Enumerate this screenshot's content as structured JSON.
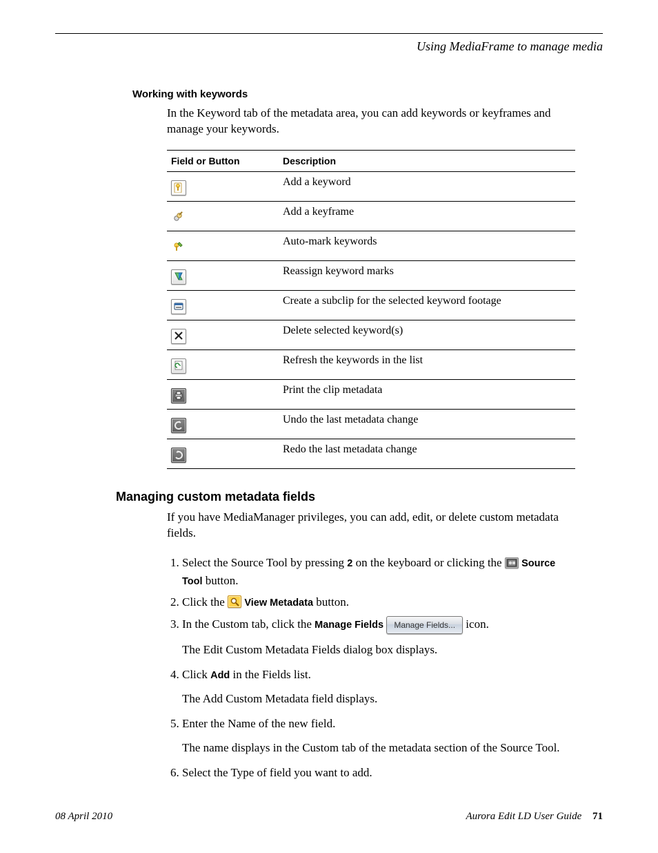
{
  "running_head": "Using MediaFrame to manage media",
  "section1": {
    "title": "Working with keywords",
    "intro": "In the Keyword tab of the metadata area, you can add keywords or keyframes and manage your keywords."
  },
  "table": {
    "head_field": "Field or Button",
    "head_desc": "Description",
    "rows": [
      {
        "icon": "add-keyword-icon",
        "desc": "Add a keyword"
      },
      {
        "icon": "add-keyframe-icon",
        "desc": "Add a keyframe"
      },
      {
        "icon": "auto-mark-icon",
        "desc": "Auto-mark keywords"
      },
      {
        "icon": "reassign-marks-icon",
        "desc": "Reassign keyword marks"
      },
      {
        "icon": "create-subclip-icon",
        "desc": "Create a subclip for the selected keyword footage"
      },
      {
        "icon": "delete-keyword-icon",
        "desc": "Delete selected keyword(s)"
      },
      {
        "icon": "refresh-list-icon",
        "desc": "Refresh the keywords in the list"
      },
      {
        "icon": "print-metadata-icon",
        "desc": "Print the clip metadata"
      },
      {
        "icon": "undo-metadata-icon",
        "desc": "Undo the last metadata change"
      },
      {
        "icon": "redo-metadata-icon",
        "desc": "Redo the last metadata change"
      }
    ]
  },
  "section2": {
    "title": "Managing custom metadata fields",
    "intro": "If you have MediaManager privileges, you can add, edit, or delete custom metadata fields.",
    "steps": {
      "s1_a": "Select the Source Tool by pressing ",
      "s1_key": "2",
      "s1_b": " on the keyboard or clicking the ",
      "s1_btn": "Source Tool",
      "s1_c": " button.",
      "s2_a": "Click the ",
      "s2_btn": "View Metadata",
      "s2_b": " button.",
      "s3_a": "In the Custom tab, click the ",
      "s3_btn": "Manage Fields",
      "s3_b": " icon.",
      "s3_btn_graphic": "Manage Fields...",
      "s3_after": "The Edit Custom Metadata Fields dialog box displays.",
      "s4_a": "Click ",
      "s4_btn": "Add",
      "s4_b": " in the Fields list.",
      "s4_after": "The Add Custom Metadata field displays.",
      "s5": "Enter the Name of the new field.",
      "s5_after": "The name displays in the Custom tab of the metadata section of the Source Tool.",
      "s6": "Select the Type of field you want to add."
    }
  },
  "footer": {
    "date": "08 April 2010",
    "booktitle": "Aurora Edit LD User Guide",
    "page": "71"
  }
}
